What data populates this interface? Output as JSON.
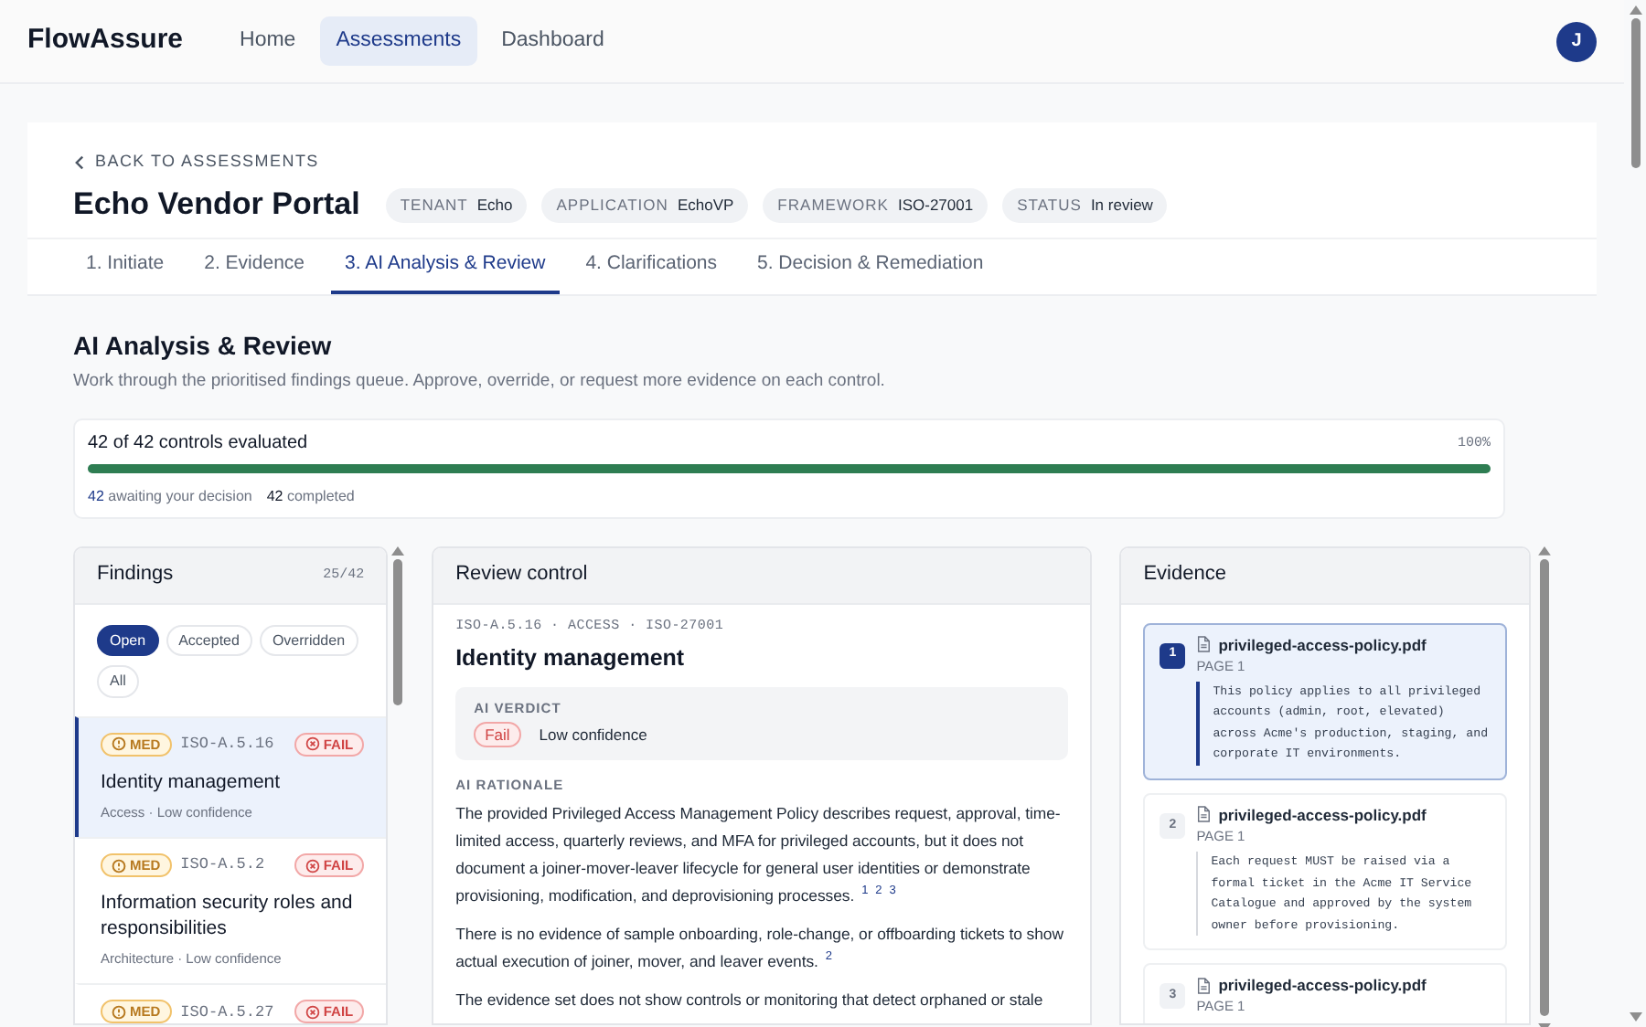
{
  "nav": {
    "brand": "FlowAssure",
    "links": [
      {
        "label": "Home",
        "selected": false
      },
      {
        "label": "Assessments",
        "selected": true
      },
      {
        "label": "Dashboard",
        "selected": false
      }
    ],
    "avatar": "J"
  },
  "header": {
    "back": "BACK TO ASSESSMENTS",
    "title": "Echo Vendor Portal",
    "tags": [
      {
        "key": "TENANT",
        "value": "Echo"
      },
      {
        "key": "APPLICATION",
        "value": "EchoVP"
      },
      {
        "key": "FRAMEWORK",
        "value": "ISO-27001"
      },
      {
        "key": "STATUS",
        "value": "In review"
      }
    ]
  },
  "steps": [
    {
      "label": "1. Initiate",
      "selected": false
    },
    {
      "label": "2. Evidence",
      "selected": false
    },
    {
      "label": "3. AI Analysis & Review",
      "selected": true
    },
    {
      "label": "4. Clarifications",
      "selected": false
    },
    {
      "label": "5. Decision & Remediation",
      "selected": false
    }
  ],
  "section": {
    "title": "AI Analysis & Review",
    "subtitle": "Work through the prioritised findings queue. Approve, override, or request more evidence on each control."
  },
  "progress": {
    "label": "42 of 42 controls evaluated",
    "percent": "100%",
    "level": 1,
    "stats": [
      {
        "kind": "pending",
        "count": "42",
        "label": "awaiting your decision"
      },
      {
        "kind": "done",
        "count": "42",
        "label": "completed"
      }
    ]
  },
  "findings": {
    "title": "Findings",
    "count": "25/42",
    "filters": [
      {
        "label": "Open",
        "selected": true
      },
      {
        "label": "Accepted",
        "selected": false
      },
      {
        "label": "Overridden",
        "selected": false
      },
      {
        "label": "All",
        "selected": false
      }
    ],
    "items": [
      {
        "severity": "MED",
        "code": "ISO-A.5.16",
        "verdict": "FAIL",
        "title": "Identity management",
        "meta": "Access · Low confidence",
        "selected": true
      },
      {
        "severity": "MED",
        "code": "ISO-A.5.2",
        "verdict": "FAIL",
        "title": "Information security roles and responsibilities",
        "meta": "Architecture · Low confidence",
        "selected": false
      },
      {
        "severity": "MED",
        "code": "ISO-A.5.27",
        "verdict": "FAIL",
        "selected": false
      }
    ]
  },
  "review": {
    "title": "Review control",
    "meta": "ISO-A.5.16 · ACCESS · ISO-27001",
    "control": "Identity management",
    "verdict": {
      "label": "AI VERDICT",
      "result": "Fail",
      "confidence": "Low confidence"
    },
    "rationale_label": "AI RATIONALE",
    "paragraphs": [
      {
        "text": "The provided Privileged Access Management Policy describes request, approval, time-limited access, quarterly reviews, and MFA for privileged accounts, but it does not document a joiner-mover-leaver lifecycle for general user identities or demonstrate provisioning, modification, and deprovisioning processes.",
        "refs": [
          "1",
          "2",
          "3"
        ]
      },
      {
        "text": "There is no evidence of sample onboarding, role-change, or offboarding tickets to show actual execution of joiner, mover, and leaver events.",
        "refs": [
          "2"
        ]
      },
      {
        "text": "The evidence set does not show controls or monitoring that detect orphaned or stale"
      }
    ]
  },
  "evidence": {
    "title": "Evidence",
    "items": [
      {
        "index": "1",
        "file": "privileged-access-policy.pdf",
        "page": "PAGE 1",
        "excerpt": "This policy applies to all privileged accounts (admin, root, elevated) across Acme's production, staging, and corporate IT environments.",
        "selected": true
      },
      {
        "index": "2",
        "file": "privileged-access-policy.pdf",
        "page": "PAGE 1",
        "excerpt": "Each request MUST be raised via a formal ticket in the Acme IT Service Catalogue and approved by the system owner before provisioning.",
        "selected": false
      },
      {
        "index": "3",
        "file": "privileged-access-policy.pdf",
        "page": "PAGE 1",
        "selected": false
      }
    ]
  }
}
